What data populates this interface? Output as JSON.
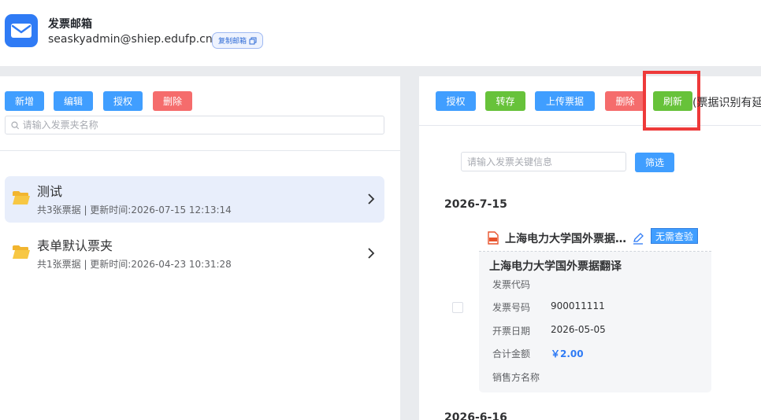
{
  "header": {
    "title": "发票邮箱",
    "email": "seaskyadmin@shiep.edufp.cn",
    "copy_label": "复制邮箱"
  },
  "left_toolbar": {
    "add": "新增",
    "edit": "编辑",
    "authorize": "授权",
    "delete": "删除"
  },
  "folder_search": {
    "placeholder": "请输入发票夹名称"
  },
  "folders": [
    {
      "name": "测试",
      "meta": "共3张票据 | 更新时间:2026-07-15 12:13:14",
      "active": true
    },
    {
      "name": "表单默认票夹",
      "meta": "共1张票据 | 更新时间:2026-04-23 10:31:28",
      "active": false
    }
  ],
  "right_toolbar": {
    "authorize": "授权",
    "transfer": "转存",
    "upload": "上传票据",
    "delete": "删除",
    "refresh": "刷新",
    "hint": "(票据识别有延"
  },
  "filter": {
    "placeholder": "请输入发票关键信息",
    "button": "筛选"
  },
  "groups": [
    {
      "date": "2026-7-15",
      "invoice": {
        "head_title": "上海电力大学国外票据翻译",
        "status": "无需查验",
        "title": "上海电力大学国外票据翻译",
        "fields": [
          {
            "label": "发票代码",
            "value": ""
          },
          {
            "label": "发票号码",
            "value": "900011111"
          },
          {
            "label": "开票日期",
            "value": "2026-05-05"
          },
          {
            "label": "合计金额",
            "value": "￥2.00"
          },
          {
            "label": "销售方名称",
            "value": ""
          }
        ]
      }
    },
    {
      "date": "2026-6-16"
    }
  ],
  "colors": {
    "primary": "#409eff",
    "success": "#67c23a",
    "danger": "#f56c6c",
    "highlight": "#ee3a3a"
  }
}
